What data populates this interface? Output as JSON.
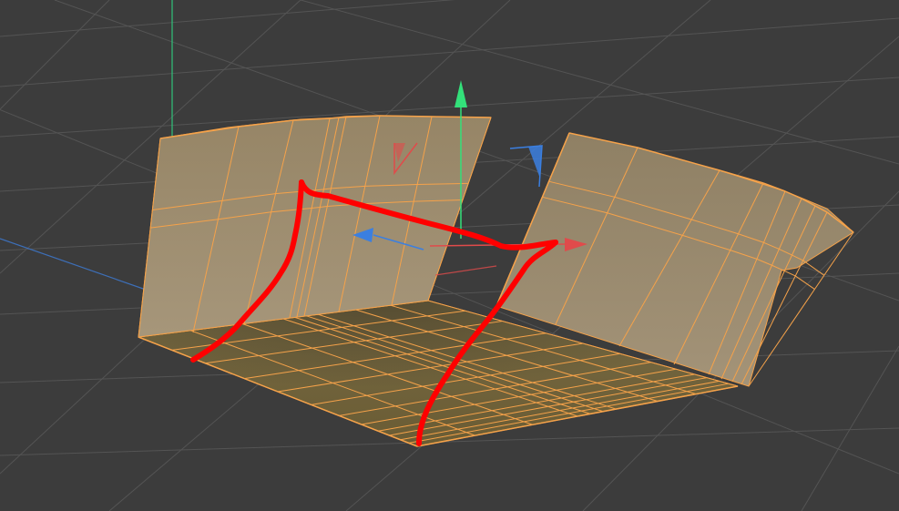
{
  "viewport": {
    "background_color": "#3c3c3c",
    "grid_color": "#545454",
    "world_y_axis_color": "#2fc27a",
    "world_x_axis_color": "#3d6fb8"
  },
  "mesh": {
    "selection_edge_color": "#f5a24a",
    "wall_face_color": "#9b8b6c",
    "floor_face_color": "#6e6038"
  },
  "gizmo": {
    "y_axis_color": "#33e07a",
    "x_axis_color": "#e04b4b",
    "z_axis_color": "#3b7fe0",
    "y_axis_icon": "arrow-up-icon",
    "x_axis_icon": "arrow-right-icon",
    "z_axis_icon": "arrow-left-icon"
  },
  "annotation": {
    "stroke_color": "#ff0000",
    "description_icon": "hand-drawn-bridge-icon"
  }
}
